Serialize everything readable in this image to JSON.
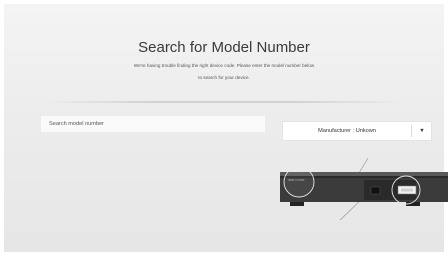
{
  "header": {
    "title": "Search for Model Number",
    "subtitle_line1": "We're having trouble finding the right device code. Please enter the model number below",
    "subtitle_line2": "to search for your device."
  },
  "search": {
    "placeholder": "Search model number"
  },
  "manufacturer": {
    "label": "Manufacturer : Unkown",
    "arrow": "▼"
  },
  "illustration": {
    "label_text": "SMP-C7000"
  }
}
